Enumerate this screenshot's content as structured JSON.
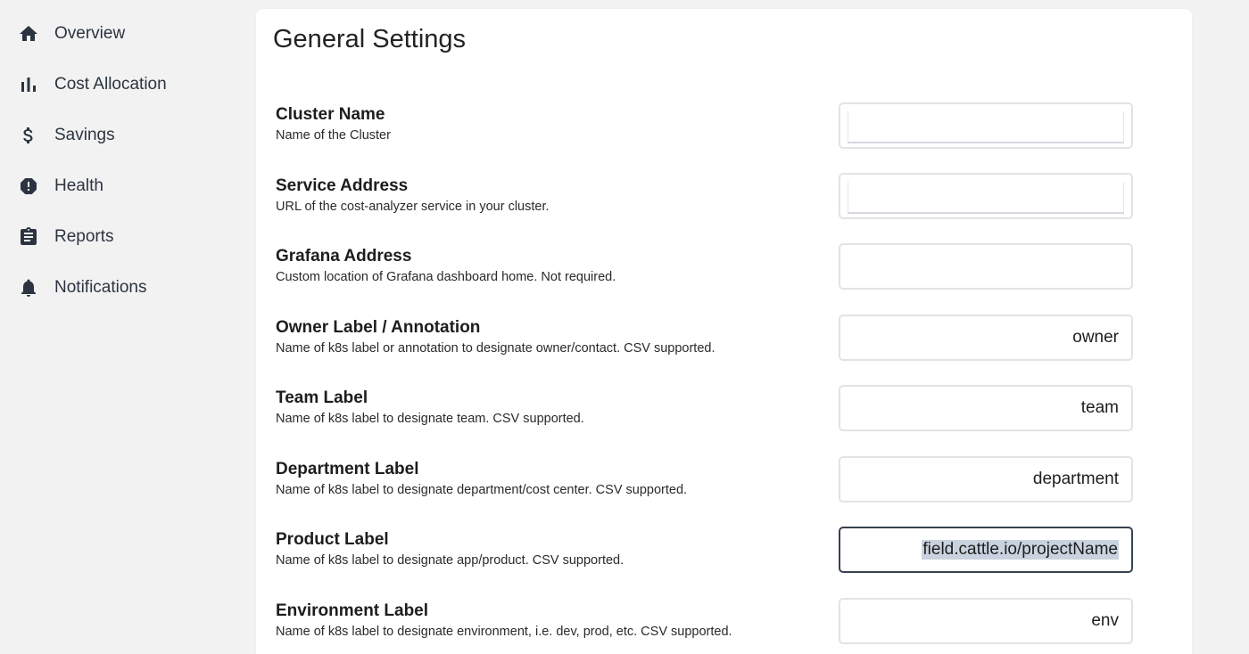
{
  "sidebar": {
    "items": [
      {
        "label": "Overview",
        "icon": "home-icon"
      },
      {
        "label": "Cost Allocation",
        "icon": "bar-chart-icon"
      },
      {
        "label": "Savings",
        "icon": "dollar-icon"
      },
      {
        "label": "Health",
        "icon": "alert-icon"
      },
      {
        "label": "Reports",
        "icon": "clipboard-icon"
      },
      {
        "label": "Notifications",
        "icon": "bell-icon"
      }
    ]
  },
  "main": {
    "title": "General Settings",
    "settings": [
      {
        "title": "Cluster Name",
        "description": "Name of the Cluster",
        "value": ""
      },
      {
        "title": "Service Address",
        "description": "URL of the cost-analyzer service in your cluster.",
        "value": ""
      },
      {
        "title": "Grafana Address",
        "description": "Custom location of Grafana dashboard home. Not required.",
        "value": ""
      },
      {
        "title": "Owner Label / Annotation",
        "description": "Name of k8s label or annotation to designate owner/contact. CSV supported.",
        "value": "owner"
      },
      {
        "title": "Team Label",
        "description": "Name of k8s label to designate team. CSV supported.",
        "value": "team"
      },
      {
        "title": "Department Label",
        "description": "Name of k8s label to designate department/cost center. CSV supported.",
        "value": "department"
      },
      {
        "title": "Product Label",
        "description": "Name of k8s label to designate app/product. CSV supported.",
        "value": "field.cattle.io/projectName"
      },
      {
        "title": "Environment Label",
        "description": "Name of k8s label to designate environment, i.e. dev, prod, etc. CSV supported.",
        "value": "env"
      }
    ]
  },
  "colors": {
    "background": "#f2f2f2",
    "card": "#ffffff",
    "sidebar_text": "#2b3440",
    "focused_border": "#38414f",
    "selection": "#c9d3df"
  }
}
